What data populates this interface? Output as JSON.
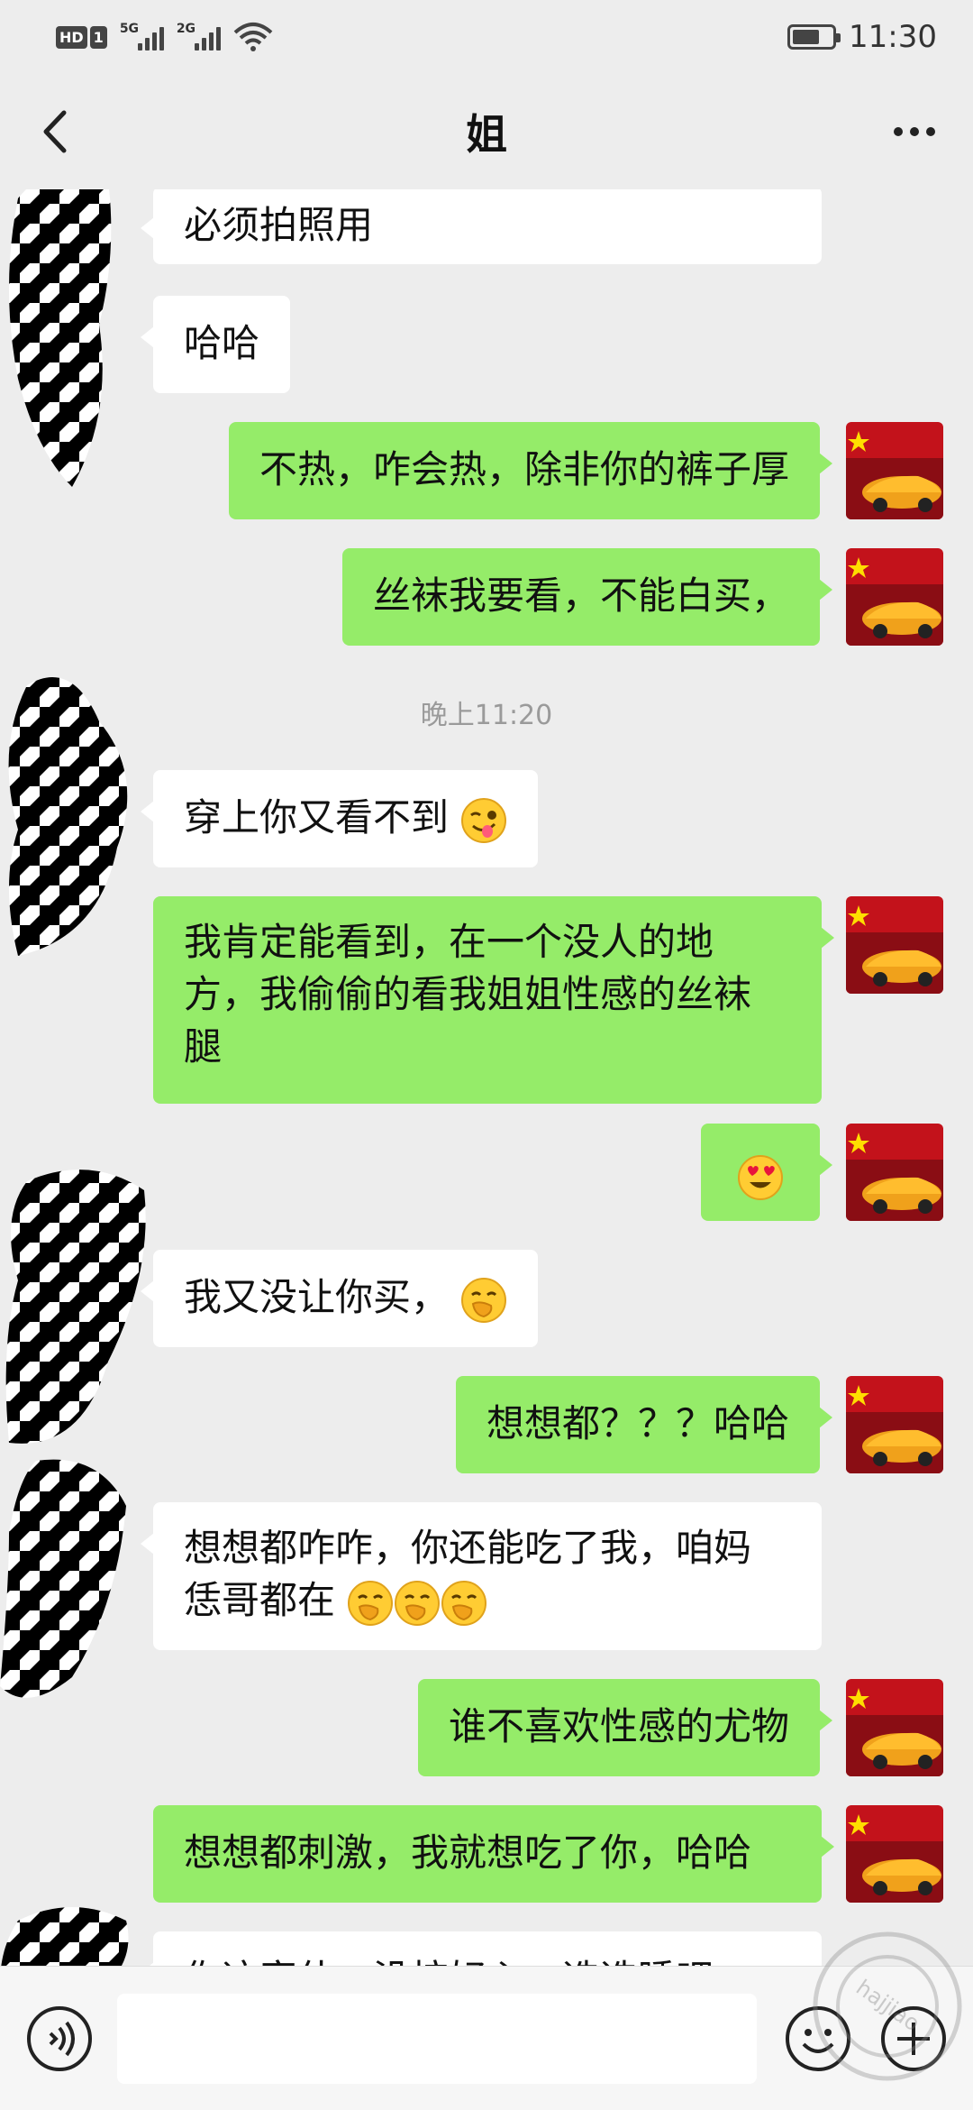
{
  "status_bar": {
    "hd": "HD",
    "sim": "1",
    "net1": "5G",
    "net2": "2G",
    "time": "11:30",
    "battery_level": 0.7
  },
  "header": {
    "title": "姐"
  },
  "messages": [
    {
      "from": "them",
      "text": "必须拍照用"
    },
    {
      "from": "them",
      "text": "哈哈"
    },
    {
      "from": "me",
      "text": "不热，咋会热，除非你的裤子厚"
    },
    {
      "from": "me",
      "text": "丝袜我要看，不能白买，"
    },
    {
      "from": "them",
      "text": "穿上你又看不到",
      "emoji": "winking-tongue-emoji"
    },
    {
      "from": "me",
      "line1": "我肯定能看到，在一个没人的地",
      "line2": "方，我偷偷的看我姐姐性感的丝袜",
      "line3": "腿"
    },
    {
      "from": "me",
      "emoji": "heart-eyes-emoji"
    },
    {
      "from": "them",
      "text": "我又没让你买，",
      "emoji": "hand-over-mouth-emoji"
    },
    {
      "from": "me",
      "text": "想想都？？？哈哈"
    },
    {
      "from": "them",
      "line1": "想想都咋咋，你还能吃了我，咱妈",
      "line2": "恁哥都在",
      "emoji": "hand-over-mouth-emoji"
    },
    {
      "from": "me",
      "text": "谁不喜欢性感的尤物"
    },
    {
      "from": "me",
      "text": "想想都刺激，我就想吃了你，哈哈"
    },
    {
      "from": "them",
      "text": "你这家伙，没按好心，选选睡吧"
    }
  ],
  "timestamp": "晚上11:20",
  "input": {
    "placeholder": ""
  },
  "watermark": {
    "text": "hajjiao"
  },
  "colors": {
    "out_bubble": "#95ec69",
    "in_bubble": "#ffffff",
    "background": "#ededed"
  }
}
